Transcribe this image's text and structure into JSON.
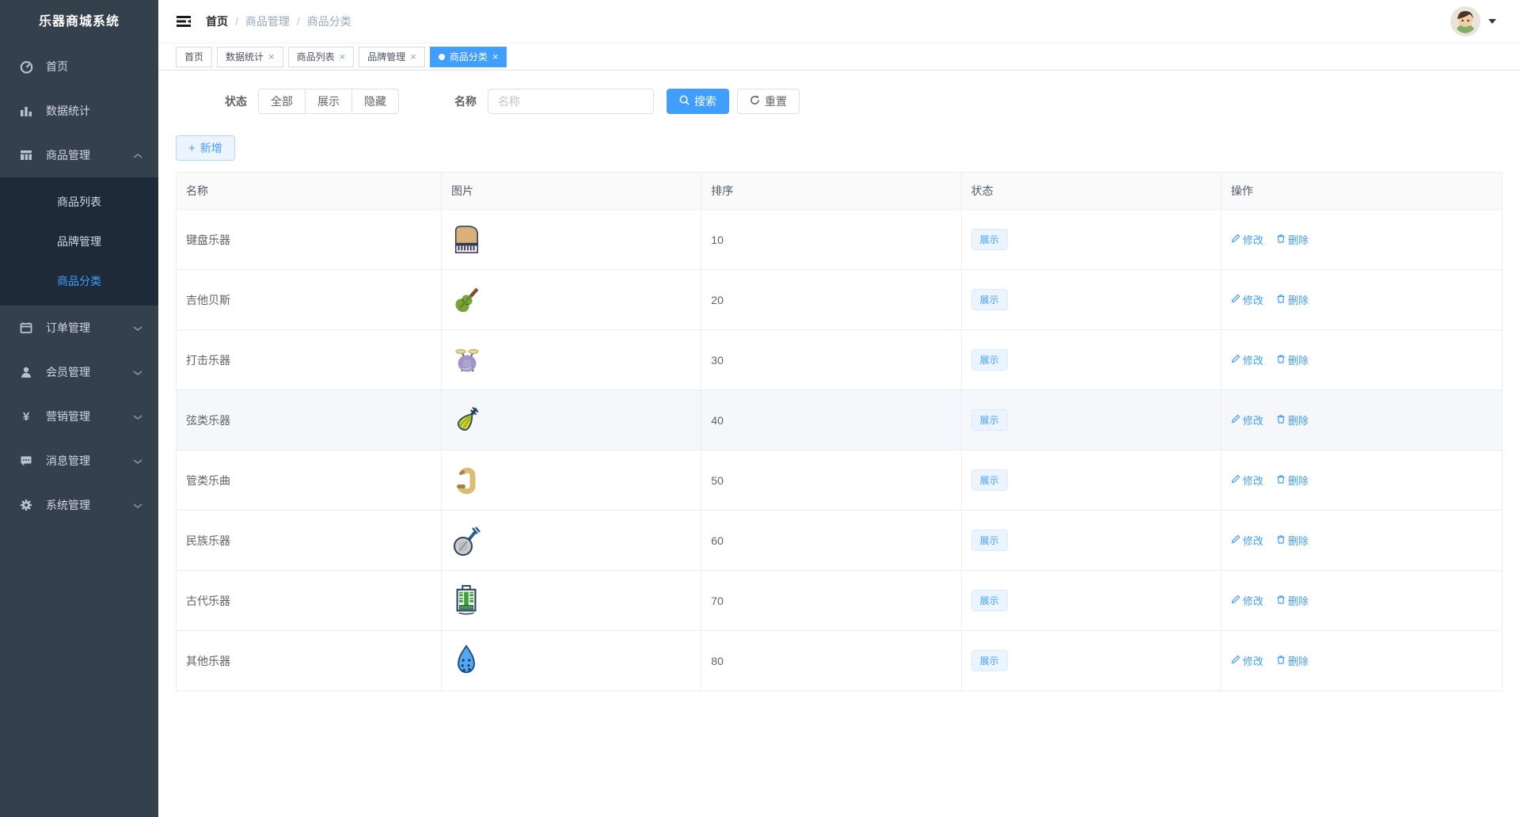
{
  "app": {
    "title": "乐器商城系统"
  },
  "sidebar": {
    "items": [
      {
        "label": "首页",
        "icon": "dashboard-icon"
      },
      {
        "label": "数据统计",
        "icon": "bar-chart-icon"
      },
      {
        "label": "商品管理",
        "icon": "grid-icon",
        "expanded": true,
        "children": [
          "商品列表",
          "品牌管理",
          "商品分类"
        ],
        "active_child": "商品分类"
      },
      {
        "label": "订单管理",
        "icon": "order-icon"
      },
      {
        "label": "会员管理",
        "icon": "user-icon"
      },
      {
        "label": "营销管理",
        "icon": "yen-icon"
      },
      {
        "label": "消息管理",
        "icon": "message-icon"
      },
      {
        "label": "系统管理",
        "icon": "gear-icon"
      }
    ]
  },
  "breadcrumb": {
    "items": [
      "首页",
      "商品管理",
      "商品分类"
    ],
    "separator": "/"
  },
  "tabs": [
    {
      "label": "首页",
      "closable": false,
      "active": false
    },
    {
      "label": "数据统计",
      "closable": true,
      "active": false
    },
    {
      "label": "商品列表",
      "closable": true,
      "active": false
    },
    {
      "label": "品牌管理",
      "closable": true,
      "active": false
    },
    {
      "label": "商品分类",
      "closable": true,
      "active": true
    }
  ],
  "filters": {
    "status_label": "状态",
    "status_options": [
      "全部",
      "展示",
      "隐藏"
    ],
    "name_label": "名称",
    "name_placeholder": "名称",
    "name_value": "",
    "search_label": "搜索",
    "reset_label": "重置"
  },
  "toolbar": {
    "add_label": "新增"
  },
  "table": {
    "columns": [
      "名称",
      "图片",
      "排序",
      "状态",
      "操作"
    ],
    "edit_label": "修改",
    "delete_label": "删除",
    "rows": [
      {
        "name": "键盘乐器",
        "icon": "piano-icon",
        "sort": "10",
        "status": "展示",
        "highlight": false
      },
      {
        "name": "吉他贝斯",
        "icon": "violin-icon",
        "sort": "20",
        "status": "展示",
        "highlight": false
      },
      {
        "name": "打击乐器",
        "icon": "drum-icon",
        "sort": "30",
        "status": "展示",
        "highlight": false
      },
      {
        "name": "弦类乐器",
        "icon": "pipa-icon",
        "sort": "40",
        "status": "展示",
        "highlight": true
      },
      {
        "name": "管类乐曲",
        "icon": "saxophone-icon",
        "sort": "50",
        "status": "展示",
        "highlight": false
      },
      {
        "name": "民族乐器",
        "icon": "banjo-icon",
        "sort": "60",
        "status": "展示",
        "highlight": false
      },
      {
        "name": "古代乐器",
        "icon": "chime-icon",
        "sort": "70",
        "status": "展示",
        "highlight": false
      },
      {
        "name": "其他乐器",
        "icon": "ocarina-icon",
        "sort": "80",
        "status": "展示",
        "highlight": false
      }
    ]
  },
  "colors": {
    "primary": "#409eff",
    "sidebar_bg": "#35404d",
    "submenu_bg": "#1e2a38",
    "tag_bg": "#ecf5ff",
    "tag_border": "#d9ecff"
  }
}
